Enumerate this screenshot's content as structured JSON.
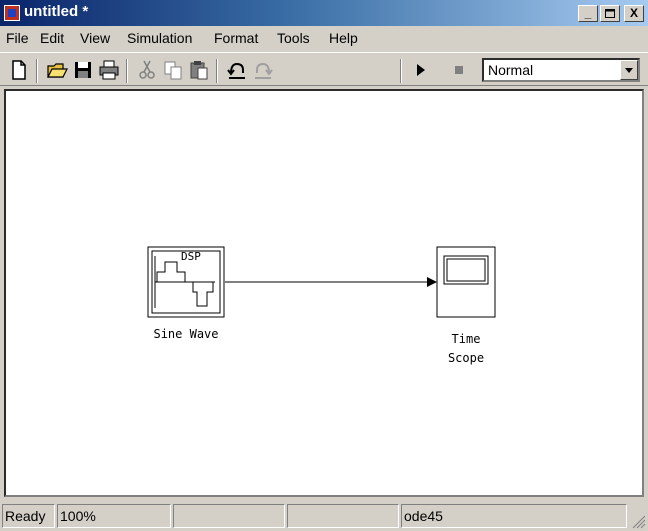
{
  "window": {
    "title": "untitled *",
    "controls": [
      "_",
      "□",
      "X"
    ]
  },
  "menu": [
    "File",
    "Edit",
    "View",
    "Simulation",
    "Format",
    "Tools",
    "Help"
  ],
  "toolbar": {
    "icons": [
      "new-document-icon",
      "open-folder-icon",
      "save-icon",
      "print-icon",
      "cut-icon",
      "copy-icon",
      "paste-icon",
      "undo-icon",
      "redo-icon",
      "play-icon",
      "stop-icon"
    ],
    "simulation_mode": "Normal"
  },
  "model": {
    "blocks": [
      {
        "id": "sine-wave",
        "label": "Sine Wave",
        "inner_text": "DSP"
      },
      {
        "id": "time-scope",
        "label_line1": "Time",
        "label_line2": "Scope"
      }
    ],
    "connections": [
      {
        "from": "sine-wave",
        "to": "time-scope"
      }
    ]
  },
  "status": {
    "ready": "Ready",
    "zoom": "100%",
    "cell3": "",
    "cell4": "",
    "solver": "ode45"
  },
  "colors": {
    "title_start": "#0a246a",
    "title_end": "#a6caf0",
    "chrome": "#d4d0c8",
    "canvas": "#ffffff"
  }
}
